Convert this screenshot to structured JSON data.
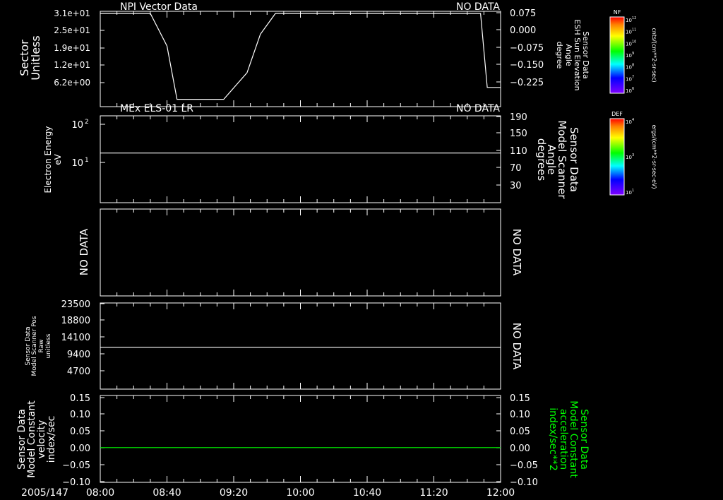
{
  "colors": {
    "background": "#000000",
    "foreground": "#ffffff",
    "accent_green": "#00ff00"
  },
  "x_axis": {
    "date_label": "2005/147",
    "tick_labels": [
      "08:00",
      "08:40",
      "09:20",
      "10:00",
      "10:40",
      "11:20",
      "12:00"
    ],
    "range": [
      "08:00",
      "12:00"
    ]
  },
  "panels": [
    {
      "title": "NPI Vector Data",
      "status_right": "NO DATA",
      "left_label": [
        "Sector",
        "Unitless"
      ],
      "left_ticks": [
        "3.1e+01",
        "2.5e+01",
        "1.9e+01",
        "1.2e+01",
        "6.2e+00"
      ],
      "right_ticks": [
        "0.075",
        "0.000",
        "−0.075",
        "−0.150",
        "−0.225"
      ],
      "right_label": [
        "Sensor Data",
        "ESH Sun Elevation",
        "Angle",
        "degree"
      ]
    },
    {
      "title": "MEx ELS-01 LR",
      "status_right": "NO DATA",
      "left_label": [
        "Electron Energy",
        "eV"
      ],
      "left_ticks": [
        "10",
        "10"
      ],
      "left_tick_exps": [
        "2",
        "1"
      ],
      "right_ticks": [
        "190",
        "150",
        "110",
        "70",
        "30"
      ],
      "right_label": [
        "Sensor Data",
        "Model Scanner",
        "Angle",
        "degrees"
      ]
    },
    {
      "title": "",
      "left_label": [
        "NO DATA"
      ],
      "right_label": [
        "NO DATA"
      ]
    },
    {
      "title": "",
      "left_ticks": [
        "23500",
        "18800",
        "14100",
        "9400",
        "4700"
      ],
      "left_label": [
        "Sensor Data",
        "Model Scanner Pos",
        "Raw",
        "unitless"
      ],
      "right_label": [
        "NO DATA"
      ]
    },
    {
      "title": "",
      "left_ticks": [
        "0.15",
        "0.10",
        "0.05",
        "0.00",
        "−0.05",
        "−0.10"
      ],
      "right_ticks": [
        "0.15",
        "0.10",
        "0.05",
        "0.00",
        "−0.05",
        "−0.10"
      ],
      "left_label": [
        "Sensor Data",
        "Model Constant",
        "velocity",
        "index/sec"
      ],
      "right_label": [
        "Sensor Data",
        "Model Constant",
        "acceleration",
        "index/sec**2"
      ]
    }
  ],
  "colorbars": [
    {
      "title": "NF",
      "tick_base": "10",
      "tick_exps": [
        "12",
        "11",
        "10",
        "9",
        "8",
        "7",
        "6"
      ],
      "unit": "cnts/(cm**2-sr-sec)"
    },
    {
      "title": "DEF",
      "tick_base": "10",
      "tick_exps": [
        "4",
        "3",
        "1"
      ],
      "unit": "ergs/(cm**2-sr-sec-eV)"
    }
  ],
  "chart_data": [
    {
      "type": "line",
      "title": "NPI Vector Data",
      "ylabel": "Sector Unitless",
      "y2label": "Sensor Data ESH Sun Elevation Angle degree",
      "ylim": [
        0,
        31
      ],
      "x": [
        "08:00",
        "08:30",
        "08:40",
        "08:46",
        "09:10",
        "09:14",
        "09:28",
        "09:36",
        "09:45",
        "11:48",
        "11:52",
        "12:00"
      ],
      "series": [
        {
          "values": [
            31,
            31,
            20,
            2,
            2,
            2,
            11,
            24,
            31,
            31,
            6,
            6
          ]
        }
      ]
    },
    {
      "type": "line",
      "title": "MEx ELS-01 LR",
      "ylabel": "Electron Energy eV",
      "yscale": "log",
      "ylim": [
        0.5,
        170
      ],
      "x": [
        "08:00",
        "12:00"
      ],
      "series": [
        {
          "values": [
            14,
            14
          ]
        }
      ]
    },
    {
      "type": "line",
      "ylabel": "Sensor Data Model Scanner Pos Raw unitless",
      "ylim": [
        0,
        23500
      ],
      "x": [
        "08:00",
        "12:00"
      ],
      "series": [
        {
          "values": [
            11400,
            11400
          ]
        }
      ]
    },
    {
      "type": "line",
      "ylabel": "Sensor Data Model Constant velocity index/sec",
      "y2label": "Sensor Data Model Constant acceleration index/sec**2",
      "ylim": [
        -0.1,
        0.15
      ],
      "x": [
        "08:00",
        "12:00"
      ],
      "series": [
        {
          "values": [
            0.0,
            0.0
          ]
        }
      ]
    }
  ]
}
